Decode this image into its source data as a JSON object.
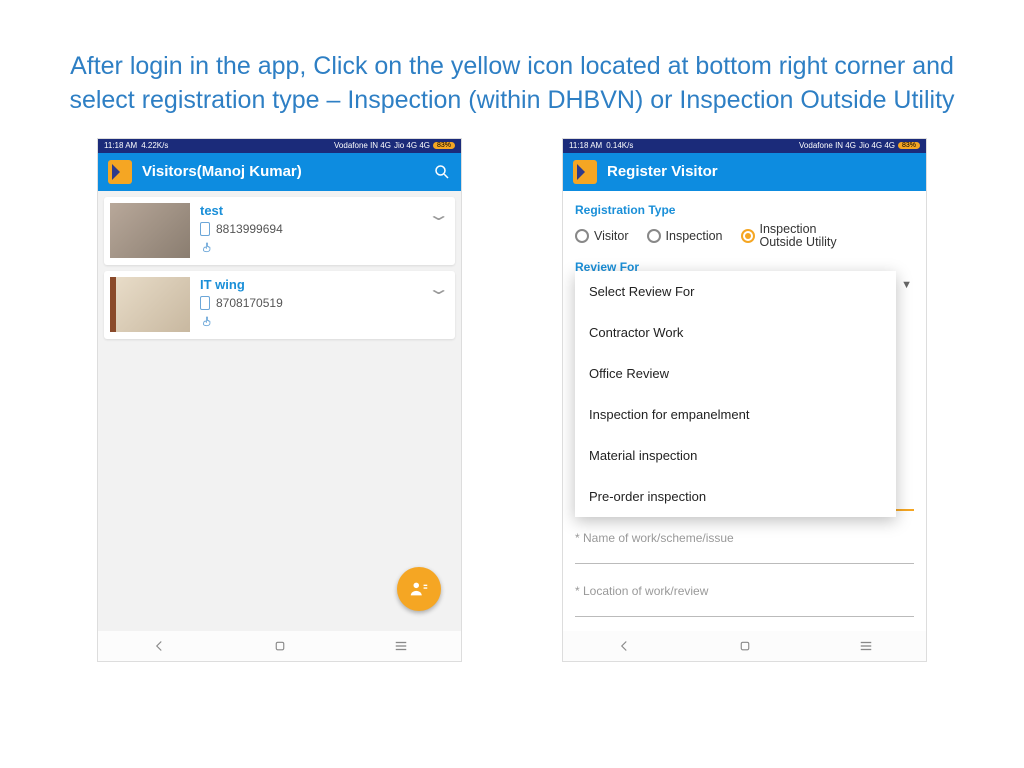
{
  "instruction": "After login in the app, Click on the yellow icon located at bottom right corner and select registration type – Inspection (within DHBVN) or Inspection Outside Utility",
  "statusbar": {
    "time": "11:18 AM",
    "speed1": "4.22K/s",
    "speed2": "0.14K/s",
    "carrier1": "Vodafone IN 4G",
    "carrier2": "Jio 4G 4G",
    "battery": "83%"
  },
  "screen1": {
    "title": "Visitors(Manoj Kumar)",
    "items": [
      {
        "name": "test",
        "phone": "8813999694"
      },
      {
        "name": "IT wing",
        "phone": "8708170519"
      }
    ]
  },
  "screen2": {
    "title": "Register Visitor",
    "regtype_label": "Registration Type",
    "radios": {
      "r1": "Visitor",
      "r2": "Inspection",
      "r3": "Inspection Outside Utility"
    },
    "review_label": "Review For",
    "dropdown": {
      "o0": "Select Review For",
      "o1": "Contractor Work",
      "o2": "Office Review",
      "o3": "Inspection for empanelment",
      "o4": "Material inspection",
      "o5": "Pre-order inspection"
    },
    "hint_name": "* Name of work/scheme/issue",
    "hint_loc": "* Location of work/review"
  }
}
